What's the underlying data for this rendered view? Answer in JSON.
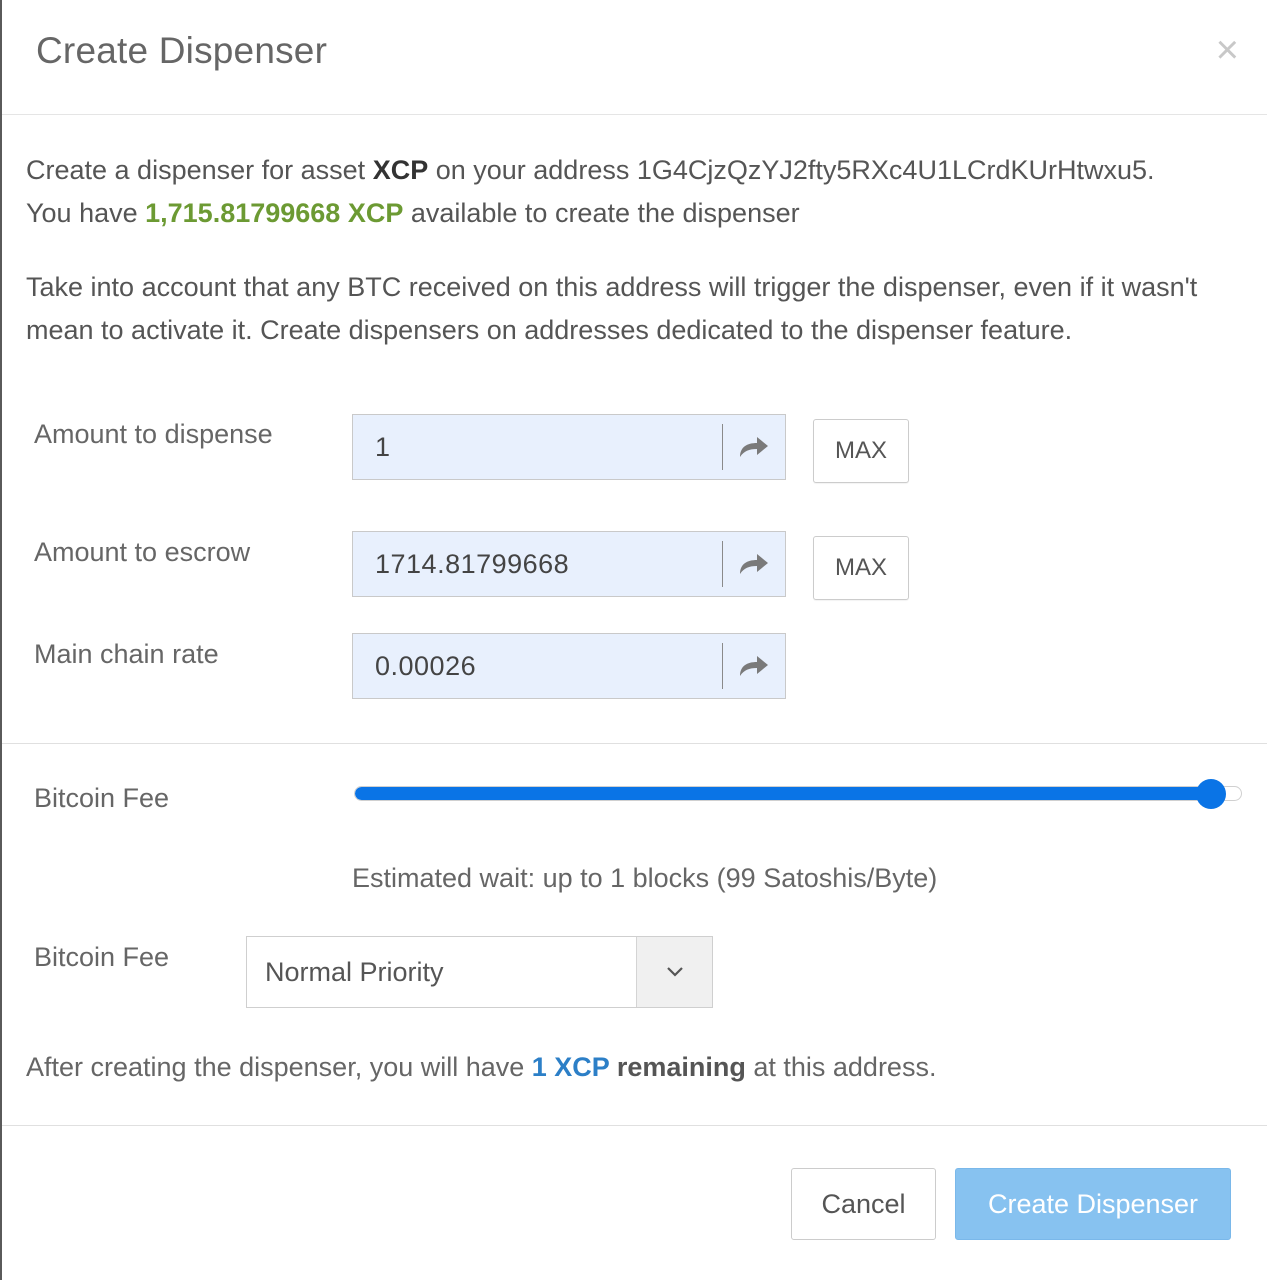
{
  "dialog": {
    "title": "Create Dispenser",
    "close_glyph": "×"
  },
  "intro": {
    "line1_prefix": "Create a dispenser for asset ",
    "asset": "XCP",
    "line1_middle": " on your address ",
    "address": "1G4CjzQzYJ2fty5RXc4U1LCrdKUrHtwxu5",
    "line1_suffix": ".",
    "line2_prefix": "You have ",
    "available": "1,715.81799668 XCP",
    "line2_suffix": " available to create the dispenser"
  },
  "warning": "Take into account that any BTC received on this address will trigger the dispenser, even if it wasn't mean to activate it. Create dispensers on addresses dedicated to the dispenser feature.",
  "form": {
    "amount_dispense": {
      "label": "Amount to dispense",
      "value": "1",
      "max_label": "MAX"
    },
    "amount_escrow": {
      "label": "Amount to escrow",
      "value": "1714.81799668",
      "max_label": "MAX"
    },
    "main_chain_rate": {
      "label": "Main chain rate",
      "value": "0.00026"
    }
  },
  "fee": {
    "slider_label": "Bitcoin Fee",
    "slider_value": 0.965,
    "estimate": "Estimated wait: up to 1 blocks (99 Satoshis/Byte)",
    "select_label": "Bitcoin Fee",
    "select_value": "Normal Priority"
  },
  "summary": {
    "prefix": "After creating the dispenser, you will have ",
    "amount": "1 XCP",
    "bold": " remaining",
    "suffix": " at this address."
  },
  "buttons": {
    "cancel": "Cancel",
    "create": "Create Dispenser"
  },
  "colors": {
    "available_green": "#6c9a33",
    "amount_blue": "#2c7fc7",
    "slider_blue": "#0a74e6",
    "primary_disabled": "#87c2f0"
  },
  "icons": {
    "close": "close-icon",
    "arrow": "share-arrow-icon",
    "caret": "chevron-down-icon"
  }
}
